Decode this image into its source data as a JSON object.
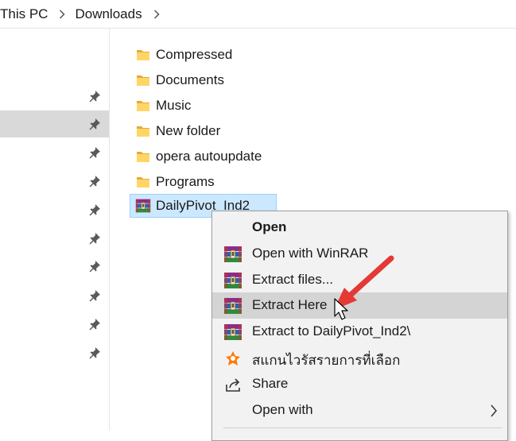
{
  "breadcrumb": {
    "items": [
      "This PC",
      "Downloads"
    ]
  },
  "nav": {
    "selected_row": 1
  },
  "files": [
    {
      "name": "Compressed",
      "icon": "folder-icon"
    },
    {
      "name": "Documents",
      "icon": "folder-icon"
    },
    {
      "name": "Music",
      "icon": "folder-icon"
    },
    {
      "name": "New folder",
      "icon": "folder-icon"
    },
    {
      "name": "opera autoupdate",
      "icon": "folder-icon"
    },
    {
      "name": "Programs",
      "icon": "folder-icon"
    },
    {
      "name": "DailyPivot_Ind2",
      "icon": "winrar-archive-icon"
    }
  ],
  "context_menu": {
    "items": [
      {
        "label": "Open",
        "icon": "",
        "bold": true
      },
      {
        "label": "Open with WinRAR",
        "icon": "winrar-icon"
      },
      {
        "label": "Extract files...",
        "icon": "winrar-icon"
      },
      {
        "label": "Extract Here",
        "icon": "winrar-icon",
        "highlighted": true
      },
      {
        "label": "Extract to DailyPivot_Ind2\\",
        "icon": "winrar-icon"
      },
      {
        "label": "สแกนไวรัสรายการที่เลือก",
        "icon": "avast-icon"
      },
      {
        "label": "Share",
        "icon": "share-icon"
      },
      {
        "label": "Open with",
        "icon": "",
        "submenu": true
      }
    ]
  },
  "colors": {
    "selection_bg": "#cce8ff",
    "selection_border": "#99d1ff",
    "menu_bg": "#f2f2f2",
    "menu_hover": "#d4d4d4",
    "annotation_arrow": "#e53935",
    "folder": "#ffc83d"
  }
}
